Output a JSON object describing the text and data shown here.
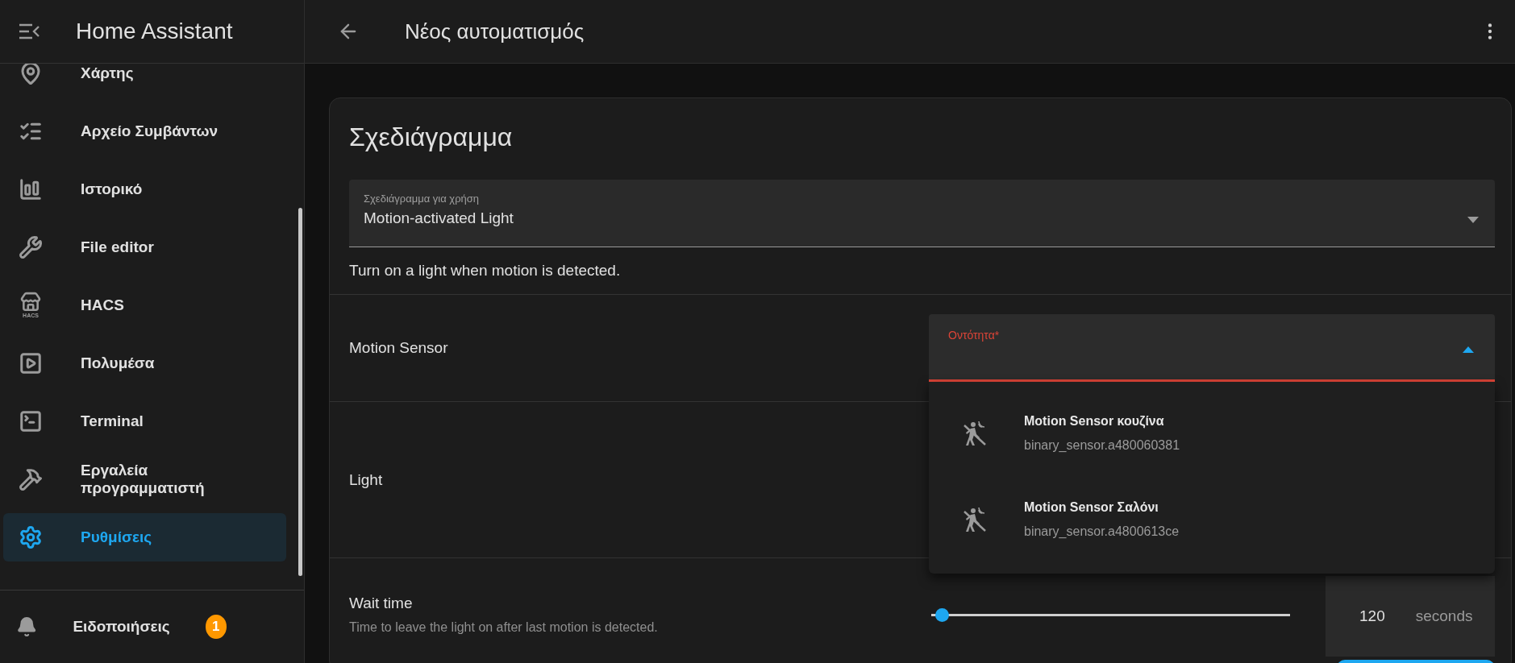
{
  "sidebar": {
    "title": "Home Assistant",
    "items": [
      {
        "label": "Χάρτης",
        "selected": false
      },
      {
        "label": "Αρχείο Συμβάντων",
        "selected": false
      },
      {
        "label": "Ιστορικό",
        "selected": false
      },
      {
        "label": "File editor",
        "selected": false
      },
      {
        "label": "HACS",
        "selected": false,
        "icon_text": "HACS"
      },
      {
        "label": "Πολυμέσα",
        "selected": false
      },
      {
        "label": "Terminal",
        "selected": false
      },
      {
        "label": "Εργαλεία προγραμματιστή",
        "selected": false
      },
      {
        "label": "Ρυθμίσεις",
        "selected": true
      }
    ],
    "notifications": {
      "label": "Ειδοποιήσεις",
      "badge": "1"
    }
  },
  "header": {
    "title": "Νέος αυτοματισμός"
  },
  "card": {
    "title": "Σχεδιάγραμμα",
    "blueprint_select": {
      "label": "Σχεδιάγραμμα για χρήση",
      "value": "Motion-activated Light"
    },
    "description": "Turn on a light when motion is detected.",
    "inputs": [
      {
        "kind": "entity",
        "label": "Motion Sensor",
        "field": {
          "label": "Οντότητα*",
          "error": true,
          "expanded": true,
          "options": [
            {
              "name": "Motion Sensor κουζίνα",
              "entity_id": "binary_sensor.a480060381"
            },
            {
              "name": "Motion Sensor Σαλόνι",
              "entity_id": "binary_sensor.a4800613ce"
            }
          ]
        }
      },
      {
        "kind": "empty",
        "label": "Light"
      },
      {
        "kind": "number",
        "label": "Wait time",
        "description": "Time to leave the light on after last motion is detected.",
        "level": 0.03,
        "value": "120",
        "unit": "seconds"
      }
    ]
  }
}
